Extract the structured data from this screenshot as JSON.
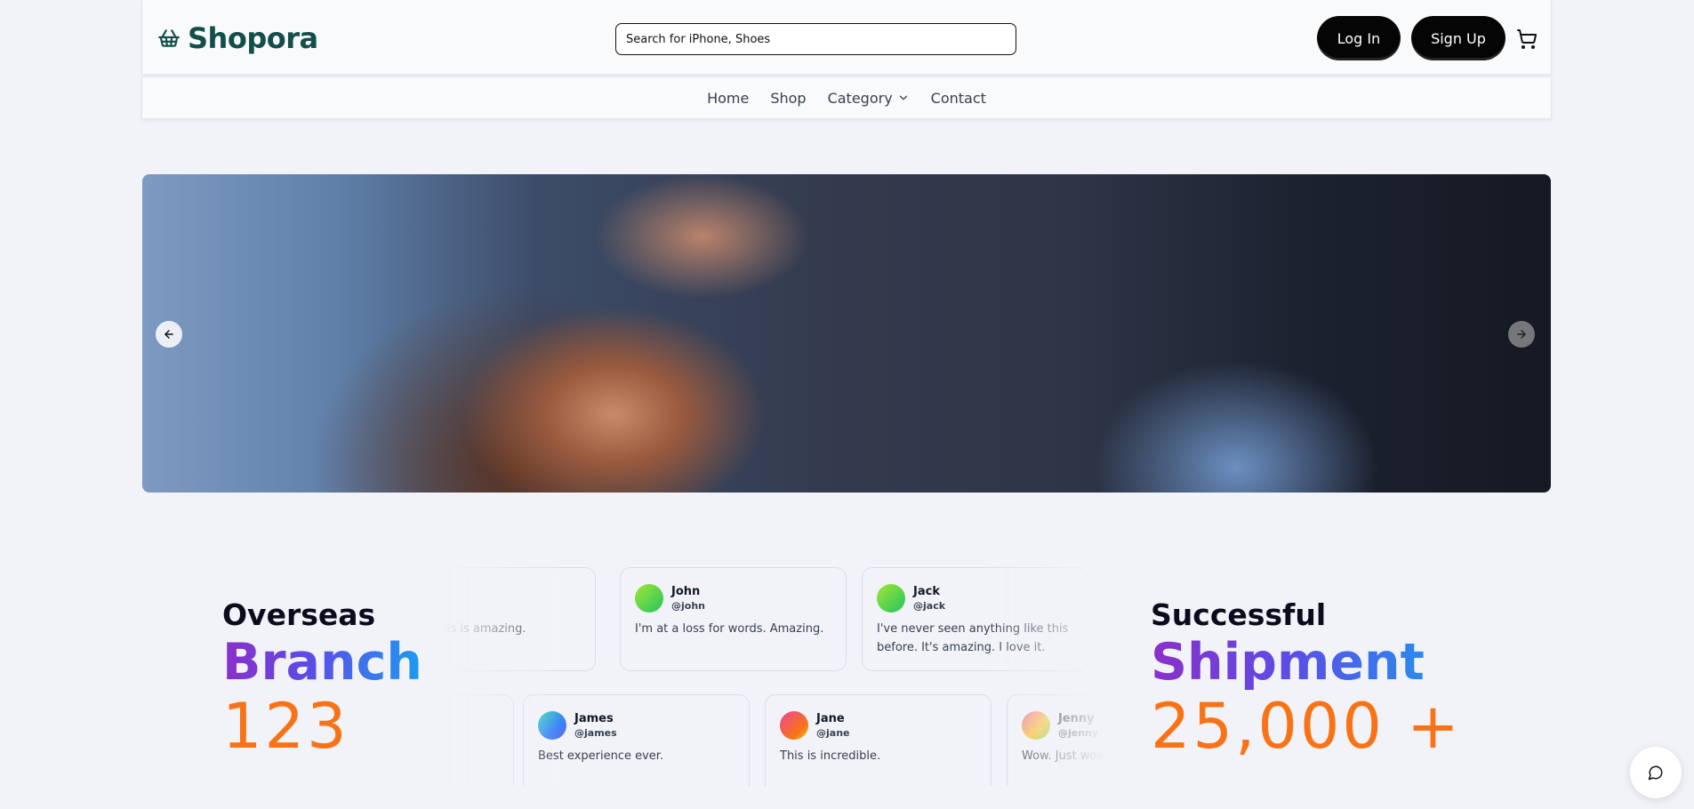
{
  "header": {
    "brand": "Shopora",
    "search_placeholder": "Search for iPhone, Shoes",
    "login_label": "Log In",
    "signup_label": "Sign Up"
  },
  "nav": {
    "items": [
      {
        "label": "Home"
      },
      {
        "label": "Shop"
      },
      {
        "label": "Category"
      },
      {
        "label": "Contact"
      }
    ]
  },
  "stats": {
    "left": {
      "label": "Overseas",
      "word": "Branch",
      "number": "123"
    },
    "right": {
      "label": "Successful",
      "word": "Shipment",
      "number": "25,000 +"
    }
  },
  "testimonials": {
    "row1": [
      {
        "name": "",
        "handle": "",
        "text": "…hless. This is amazing."
      },
      {
        "name": "John",
        "handle": "@john",
        "text": "I'm at a loss for words. Amazing."
      },
      {
        "name": "Jack",
        "handle": "@jack",
        "text": "I've never seen anything like this before. It's amazing. I love it."
      }
    ],
    "row2": [
      {
        "name": "",
        "handle": "",
        "text": ""
      },
      {
        "name": "James",
        "handle": "@james",
        "text": "Best experience ever."
      },
      {
        "name": "Jane",
        "handle": "@jane",
        "text": "This is incredible."
      },
      {
        "name": "Jenny",
        "handle": "@jenny",
        "text": "Wow. Just wow."
      }
    ]
  },
  "colors": {
    "brand": "#134e4a",
    "accent_orange": "#f97316",
    "gradient_start": "#8b2fc9",
    "gradient_end": "#1d9bf0"
  },
  "icons": {
    "logo": "basket-icon",
    "cart": "cart-icon",
    "category": "chevron-down-icon",
    "prev": "arrow-left-icon",
    "next": "arrow-right-icon",
    "chat": "chat-bubble-icon"
  }
}
